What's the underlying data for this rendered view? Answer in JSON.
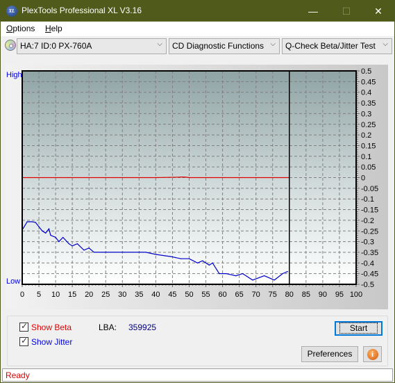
{
  "window": {
    "title": "PlexTools Professional XL V3.16",
    "app_icon_text": "XL",
    "controls": {
      "minimize": "—",
      "maximize": "☐",
      "close": "✕"
    }
  },
  "menu": {
    "items": [
      {
        "label": "Options",
        "mnemonic": "O"
      },
      {
        "label": "Help",
        "mnemonic": "H"
      }
    ]
  },
  "toolbar": {
    "drive_select": "HA:7 ID:0  PX-760A",
    "function_select": "CD Diagnostic Functions",
    "test_select": "Q-Check Beta/Jitter Test",
    "chevron": "⌵"
  },
  "chart_data": {
    "type": "line",
    "title": "",
    "left_axis_labels": {
      "high": "High",
      "low": "Low"
    },
    "x_ticks": [
      0,
      5,
      10,
      15,
      20,
      25,
      30,
      35,
      40,
      45,
      50,
      55,
      60,
      65,
      70,
      75,
      80,
      85,
      90,
      95,
      100
    ],
    "y_ticks": [
      0.5,
      0.45,
      0.4,
      0.35,
      0.3,
      0.25,
      0.2,
      0.15,
      0.1,
      0.05,
      0,
      -0.05,
      -0.1,
      -0.15,
      -0.2,
      -0.25,
      -0.3,
      -0.35,
      -0.4,
      -0.45,
      -0.5
    ],
    "xlim": [
      0,
      100
    ],
    "ylim": [
      -0.5,
      0.5
    ],
    "grid": true,
    "position_marker_x": 80,
    "colors": {
      "beta": "#e00000",
      "jitter": "#0000c8",
      "marker": "#000000"
    },
    "series": [
      {
        "name": "Beta",
        "x": [
          0,
          10,
          20,
          30,
          40,
          47,
          48,
          49,
          50,
          60,
          70,
          80
        ],
        "y": [
          0,
          0,
          0,
          0,
          0,
          0.002,
          0.003,
          0.002,
          0,
          0,
          0,
          0
        ]
      },
      {
        "name": "Jitter",
        "x": [
          0.2,
          1.5,
          3,
          4,
          5,
          6,
          7,
          8,
          8.5,
          10,
          11,
          12.2,
          14,
          15,
          16.5,
          18.5,
          20,
          21.5,
          25,
          28,
          33,
          37,
          40,
          44.5,
          47.5,
          50,
          52.5,
          54,
          56,
          57,
          59,
          61,
          64,
          66,
          69,
          72.5,
          75.5,
          78,
          79.5
        ],
        "y": [
          -0.24,
          -0.207,
          -0.207,
          -0.21,
          -0.23,
          -0.25,
          -0.26,
          -0.24,
          -0.27,
          -0.28,
          -0.3,
          -0.28,
          -0.31,
          -0.32,
          -0.31,
          -0.34,
          -0.33,
          -0.35,
          -0.35,
          -0.35,
          -0.35,
          -0.35,
          -0.36,
          -0.37,
          -0.38,
          -0.38,
          -0.4,
          -0.39,
          -0.41,
          -0.4,
          -0.45,
          -0.45,
          -0.46,
          -0.45,
          -0.48,
          -0.46,
          -0.48,
          -0.45,
          -0.44
        ]
      }
    ]
  },
  "options": {
    "show_beta": {
      "label": "Show Beta",
      "checked": true,
      "color": "#e00000"
    },
    "show_jitter": {
      "label": "Show Jitter",
      "checked": true,
      "color": "#0000e0"
    },
    "lba_label": "LBA:",
    "lba_value": "359925"
  },
  "buttons": {
    "start": "Start",
    "preferences": "Preferences",
    "info_icon": "i"
  },
  "status": {
    "text": "Ready"
  }
}
